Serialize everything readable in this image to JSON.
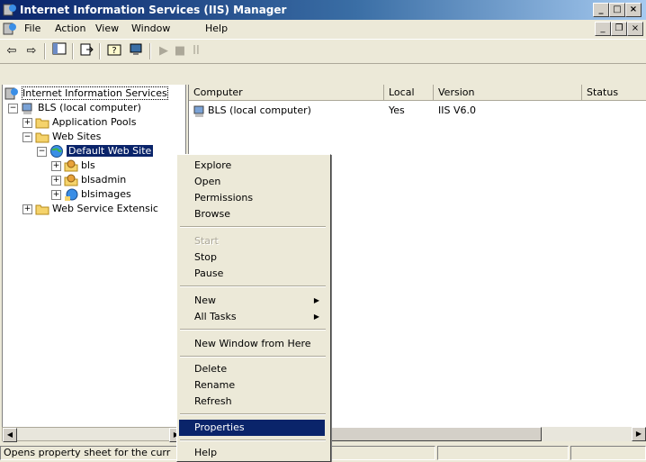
{
  "window": {
    "title": "Internet Information Services (IIS) Manager"
  },
  "menubar": {
    "items": [
      "File",
      "Action",
      "View",
      "Window",
      "Help"
    ]
  },
  "tree": {
    "items": [
      {
        "label": "Internet Information Services",
        "icon": "iis-icon"
      },
      {
        "label": "BLS (local computer)",
        "icon": "computer-icon"
      },
      {
        "label": "Application Pools",
        "icon": "folder-icon"
      },
      {
        "label": "Web Sites",
        "icon": "folder-icon"
      },
      {
        "label": "Default Web Site",
        "icon": "globe-icon"
      },
      {
        "label": "bls",
        "icon": "gear-folder-icon"
      },
      {
        "label": "blsadmin",
        "icon": "gear-folder-icon"
      },
      {
        "label": "blsimages",
        "icon": "web-app-icon"
      },
      {
        "label": "Web Service Extensic",
        "icon": "folder-icon"
      }
    ]
  },
  "list": {
    "columns": [
      "Computer",
      "Local",
      "Version",
      "Status"
    ],
    "rows": [
      {
        "computer": "BLS (local computer)",
        "local": "Yes",
        "version": "IIS V6.0",
        "status": ""
      }
    ]
  },
  "context_menu": {
    "items": [
      {
        "label": "Explore"
      },
      {
        "label": "Open"
      },
      {
        "label": "Permissions"
      },
      {
        "label": "Browse"
      },
      {
        "label": "Start"
      },
      {
        "label": "Stop"
      },
      {
        "label": "Pause"
      },
      {
        "label": "New"
      },
      {
        "label": "All Tasks"
      },
      {
        "label": "New Window from Here"
      },
      {
        "label": "Delete"
      },
      {
        "label": "Rename"
      },
      {
        "label": "Refresh"
      },
      {
        "label": "Properties"
      },
      {
        "label": "Help"
      }
    ]
  },
  "statusbar": {
    "text": "Opens property sheet for the curr"
  },
  "colors": {
    "selection": "#0a246a",
    "title_start": "#0a246a",
    "face": "#ece9d8"
  }
}
